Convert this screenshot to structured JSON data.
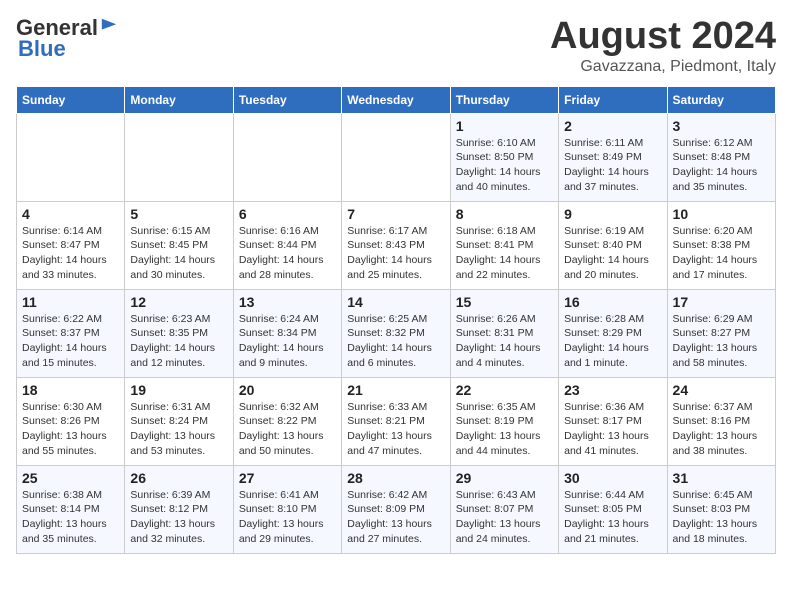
{
  "header": {
    "logo_line1": "General",
    "logo_line2": "Blue",
    "month_year": "August 2024",
    "location": "Gavazzana, Piedmont, Italy"
  },
  "days_of_week": [
    "Sunday",
    "Monday",
    "Tuesday",
    "Wednesday",
    "Thursday",
    "Friday",
    "Saturday"
  ],
  "weeks": [
    [
      {
        "day": "",
        "info": ""
      },
      {
        "day": "",
        "info": ""
      },
      {
        "day": "",
        "info": ""
      },
      {
        "day": "",
        "info": ""
      },
      {
        "day": "1",
        "info": "Sunrise: 6:10 AM\nSunset: 8:50 PM\nDaylight: 14 hours\nand 40 minutes."
      },
      {
        "day": "2",
        "info": "Sunrise: 6:11 AM\nSunset: 8:49 PM\nDaylight: 14 hours\nand 37 minutes."
      },
      {
        "day": "3",
        "info": "Sunrise: 6:12 AM\nSunset: 8:48 PM\nDaylight: 14 hours\nand 35 minutes."
      }
    ],
    [
      {
        "day": "4",
        "info": "Sunrise: 6:14 AM\nSunset: 8:47 PM\nDaylight: 14 hours\nand 33 minutes."
      },
      {
        "day": "5",
        "info": "Sunrise: 6:15 AM\nSunset: 8:45 PM\nDaylight: 14 hours\nand 30 minutes."
      },
      {
        "day": "6",
        "info": "Sunrise: 6:16 AM\nSunset: 8:44 PM\nDaylight: 14 hours\nand 28 minutes."
      },
      {
        "day": "7",
        "info": "Sunrise: 6:17 AM\nSunset: 8:43 PM\nDaylight: 14 hours\nand 25 minutes."
      },
      {
        "day": "8",
        "info": "Sunrise: 6:18 AM\nSunset: 8:41 PM\nDaylight: 14 hours\nand 22 minutes."
      },
      {
        "day": "9",
        "info": "Sunrise: 6:19 AM\nSunset: 8:40 PM\nDaylight: 14 hours\nand 20 minutes."
      },
      {
        "day": "10",
        "info": "Sunrise: 6:20 AM\nSunset: 8:38 PM\nDaylight: 14 hours\nand 17 minutes."
      }
    ],
    [
      {
        "day": "11",
        "info": "Sunrise: 6:22 AM\nSunset: 8:37 PM\nDaylight: 14 hours\nand 15 minutes."
      },
      {
        "day": "12",
        "info": "Sunrise: 6:23 AM\nSunset: 8:35 PM\nDaylight: 14 hours\nand 12 minutes."
      },
      {
        "day": "13",
        "info": "Sunrise: 6:24 AM\nSunset: 8:34 PM\nDaylight: 14 hours\nand 9 minutes."
      },
      {
        "day": "14",
        "info": "Sunrise: 6:25 AM\nSunset: 8:32 PM\nDaylight: 14 hours\nand 6 minutes."
      },
      {
        "day": "15",
        "info": "Sunrise: 6:26 AM\nSunset: 8:31 PM\nDaylight: 14 hours\nand 4 minutes."
      },
      {
        "day": "16",
        "info": "Sunrise: 6:28 AM\nSunset: 8:29 PM\nDaylight: 14 hours\nand 1 minute."
      },
      {
        "day": "17",
        "info": "Sunrise: 6:29 AM\nSunset: 8:27 PM\nDaylight: 13 hours\nand 58 minutes."
      }
    ],
    [
      {
        "day": "18",
        "info": "Sunrise: 6:30 AM\nSunset: 8:26 PM\nDaylight: 13 hours\nand 55 minutes."
      },
      {
        "day": "19",
        "info": "Sunrise: 6:31 AM\nSunset: 8:24 PM\nDaylight: 13 hours\nand 53 minutes."
      },
      {
        "day": "20",
        "info": "Sunrise: 6:32 AM\nSunset: 8:22 PM\nDaylight: 13 hours\nand 50 minutes."
      },
      {
        "day": "21",
        "info": "Sunrise: 6:33 AM\nSunset: 8:21 PM\nDaylight: 13 hours\nand 47 minutes."
      },
      {
        "day": "22",
        "info": "Sunrise: 6:35 AM\nSunset: 8:19 PM\nDaylight: 13 hours\nand 44 minutes."
      },
      {
        "day": "23",
        "info": "Sunrise: 6:36 AM\nSunset: 8:17 PM\nDaylight: 13 hours\nand 41 minutes."
      },
      {
        "day": "24",
        "info": "Sunrise: 6:37 AM\nSunset: 8:16 PM\nDaylight: 13 hours\nand 38 minutes."
      }
    ],
    [
      {
        "day": "25",
        "info": "Sunrise: 6:38 AM\nSunset: 8:14 PM\nDaylight: 13 hours\nand 35 minutes."
      },
      {
        "day": "26",
        "info": "Sunrise: 6:39 AM\nSunset: 8:12 PM\nDaylight: 13 hours\nand 32 minutes."
      },
      {
        "day": "27",
        "info": "Sunrise: 6:41 AM\nSunset: 8:10 PM\nDaylight: 13 hours\nand 29 minutes."
      },
      {
        "day": "28",
        "info": "Sunrise: 6:42 AM\nSunset: 8:09 PM\nDaylight: 13 hours\nand 27 minutes."
      },
      {
        "day": "29",
        "info": "Sunrise: 6:43 AM\nSunset: 8:07 PM\nDaylight: 13 hours\nand 24 minutes."
      },
      {
        "day": "30",
        "info": "Sunrise: 6:44 AM\nSunset: 8:05 PM\nDaylight: 13 hours\nand 21 minutes."
      },
      {
        "day": "31",
        "info": "Sunrise: 6:45 AM\nSunset: 8:03 PM\nDaylight: 13 hours\nand 18 minutes."
      }
    ]
  ]
}
